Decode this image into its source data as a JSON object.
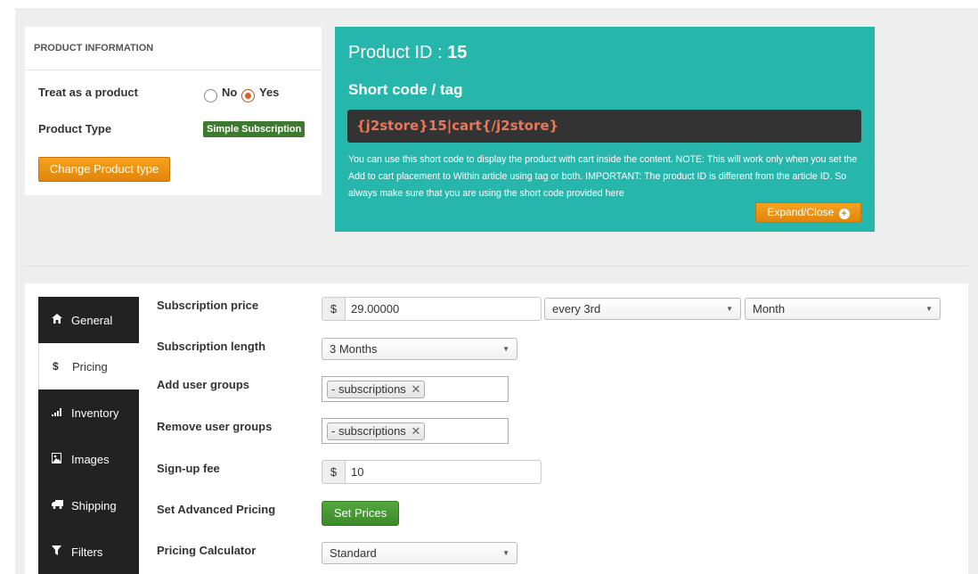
{
  "product_info": {
    "header": "PRODUCT INFORMATION",
    "treat_label": "Treat as a product",
    "radio_no": "No",
    "radio_yes": "Yes",
    "type_label": "Product Type",
    "type_badge": "Simple Subscription",
    "change_button": "Change Product type"
  },
  "shortcode": {
    "pid_prefix": "Product ID : ",
    "pid": "15",
    "title": "Short code / tag",
    "code": "{j2store}15|cart{/j2store}",
    "note": "You can use this short code to display the product with cart inside the content. NOTE: This will work only when you set the Add to cart placement to Within article using tag or both. IMPORTANT: The product ID is different from the article ID. So always make sure that you are using the short code provided here",
    "expand_button": "Expand/Close"
  },
  "sidebar": {
    "items": [
      {
        "label": "General",
        "icon": "home-icon"
      },
      {
        "label": "Pricing",
        "icon": "dollar-icon"
      },
      {
        "label": "Inventory",
        "icon": "signal-icon"
      },
      {
        "label": "Images",
        "icon": "image-icon"
      },
      {
        "label": "Shipping",
        "icon": "truck-icon"
      },
      {
        "label": "Filters",
        "icon": "filter-icon"
      }
    ]
  },
  "form": {
    "sub_price_label": "Subscription price",
    "currency": "$",
    "sub_price_value": "29.00000",
    "interval_select": "every 3rd",
    "unit_select": "Month",
    "sub_length_label": "Subscription length",
    "sub_length_select": "3 Months",
    "add_groups_label": "Add user groups",
    "add_groups_tag": "- subscriptions",
    "remove_groups_label": "Remove user groups",
    "remove_groups_tag": "- subscriptions",
    "signup_label": "Sign-up fee",
    "signup_value": "10",
    "adv_pricing_label": "Set Advanced Pricing",
    "set_prices_button": "Set Prices",
    "calc_label": "Pricing Calculator",
    "calc_select": "Standard"
  }
}
